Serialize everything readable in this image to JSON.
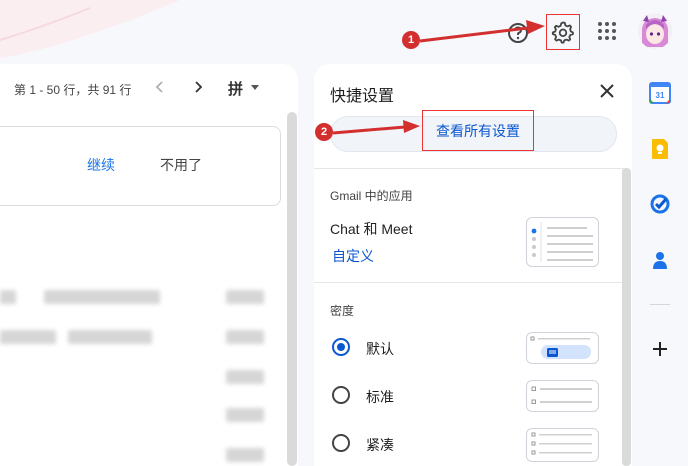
{
  "toolbar": {
    "help_icon": "help-circle-icon",
    "settings_icon": "gear-icon",
    "apps_icon": "apps-grid-icon",
    "avatar": "user-avatar"
  },
  "mail": {
    "pager_text": "第 1 - 50 行，共 91 行",
    "ime_text": "拼",
    "promo": {
      "continue_label": "继续",
      "dismiss_label": "不用了"
    }
  },
  "quick_settings": {
    "title": "快捷设置",
    "view_all_label": "查看所有设置",
    "apps_section_title": "Gmail 中的应用",
    "chat_meet_label": "Chat 和 Meet",
    "customize_label": "自定义",
    "density_title": "密度",
    "density_options": [
      {
        "label": "默认",
        "checked": true
      },
      {
        "label": "标准",
        "checked": false
      },
      {
        "label": "紧凑",
        "checked": false
      }
    ]
  },
  "side_apps": {
    "calendar_day": "31",
    "items": [
      "calendar-icon",
      "keep-icon",
      "tasks-icon",
      "contacts-icon",
      "add-icon"
    ]
  },
  "annotations": {
    "step1": "1",
    "step2": "2",
    "color": "#d32f2f"
  },
  "colors": {
    "accent_blue": "#0b57d0",
    "highlight_red": "#e33333"
  }
}
